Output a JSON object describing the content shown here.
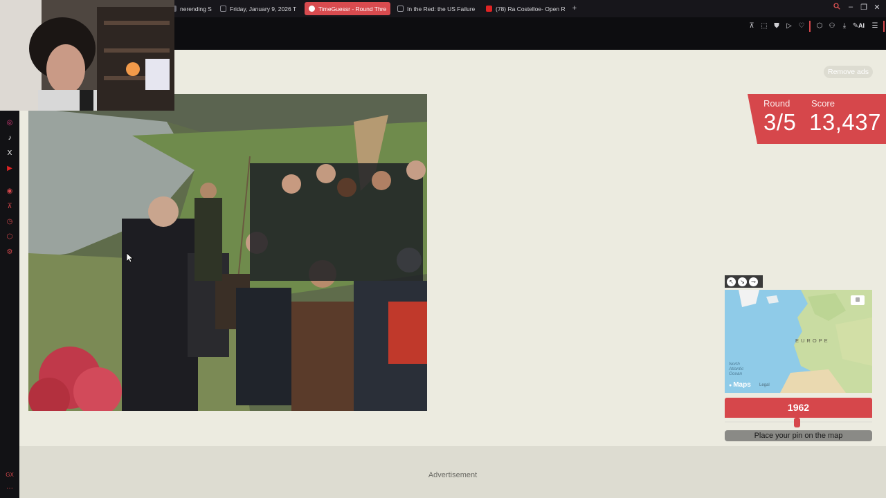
{
  "browser": {
    "tabs": [
      {
        "label": "nerending Sto",
        "icon_color": "#6b6b73",
        "active": false
      },
      {
        "label": "Friday, January 9, 2026 T",
        "icon_color": "#8a8a92",
        "active": false
      },
      {
        "label": "TimeGuessr - Round Thre",
        "icon_color": "#ffffff",
        "active": true
      },
      {
        "label": "In the Red: the US Failure",
        "icon_color": "#9a9aa2",
        "active": false
      },
      {
        "label": "(78) Ra Costelloe- Open R",
        "icon_color": "#e02424",
        "active": false
      }
    ],
    "new_tab": "+",
    "toolbar_ai": "AI"
  },
  "page": {
    "remove_ads": "Remove ads",
    "round_label": "Round",
    "round_value": "3/5",
    "score_label": "Score",
    "score_value": "13,437",
    "map": {
      "region_label": "EUROPE",
      "ocean_label": "North Atlantic Ocean",
      "brand": "Maps",
      "legal": "Legal"
    },
    "year": "1962",
    "year_slider_fraction": 0.49,
    "place_pin": "Place your pin on the map",
    "advertisement": "Advertisement"
  },
  "colors": {
    "accent": "#d6474b",
    "page_bg": "#ecebe0"
  },
  "icons": {
    "sidebar": [
      "instagram-icon",
      "tiktok-icon",
      "x-icon",
      "youtube-icon",
      "player-icon",
      "pin-icon",
      "clock-icon",
      "chat-icon",
      "settings-icon"
    ],
    "toolbar": [
      "pin-icon",
      "screenshot-icon",
      "shield-icon",
      "play-icon",
      "heart-icon",
      "chat-icon",
      "account-icon",
      "download-icon",
      "ai-icon",
      "menu-icon"
    ]
  }
}
